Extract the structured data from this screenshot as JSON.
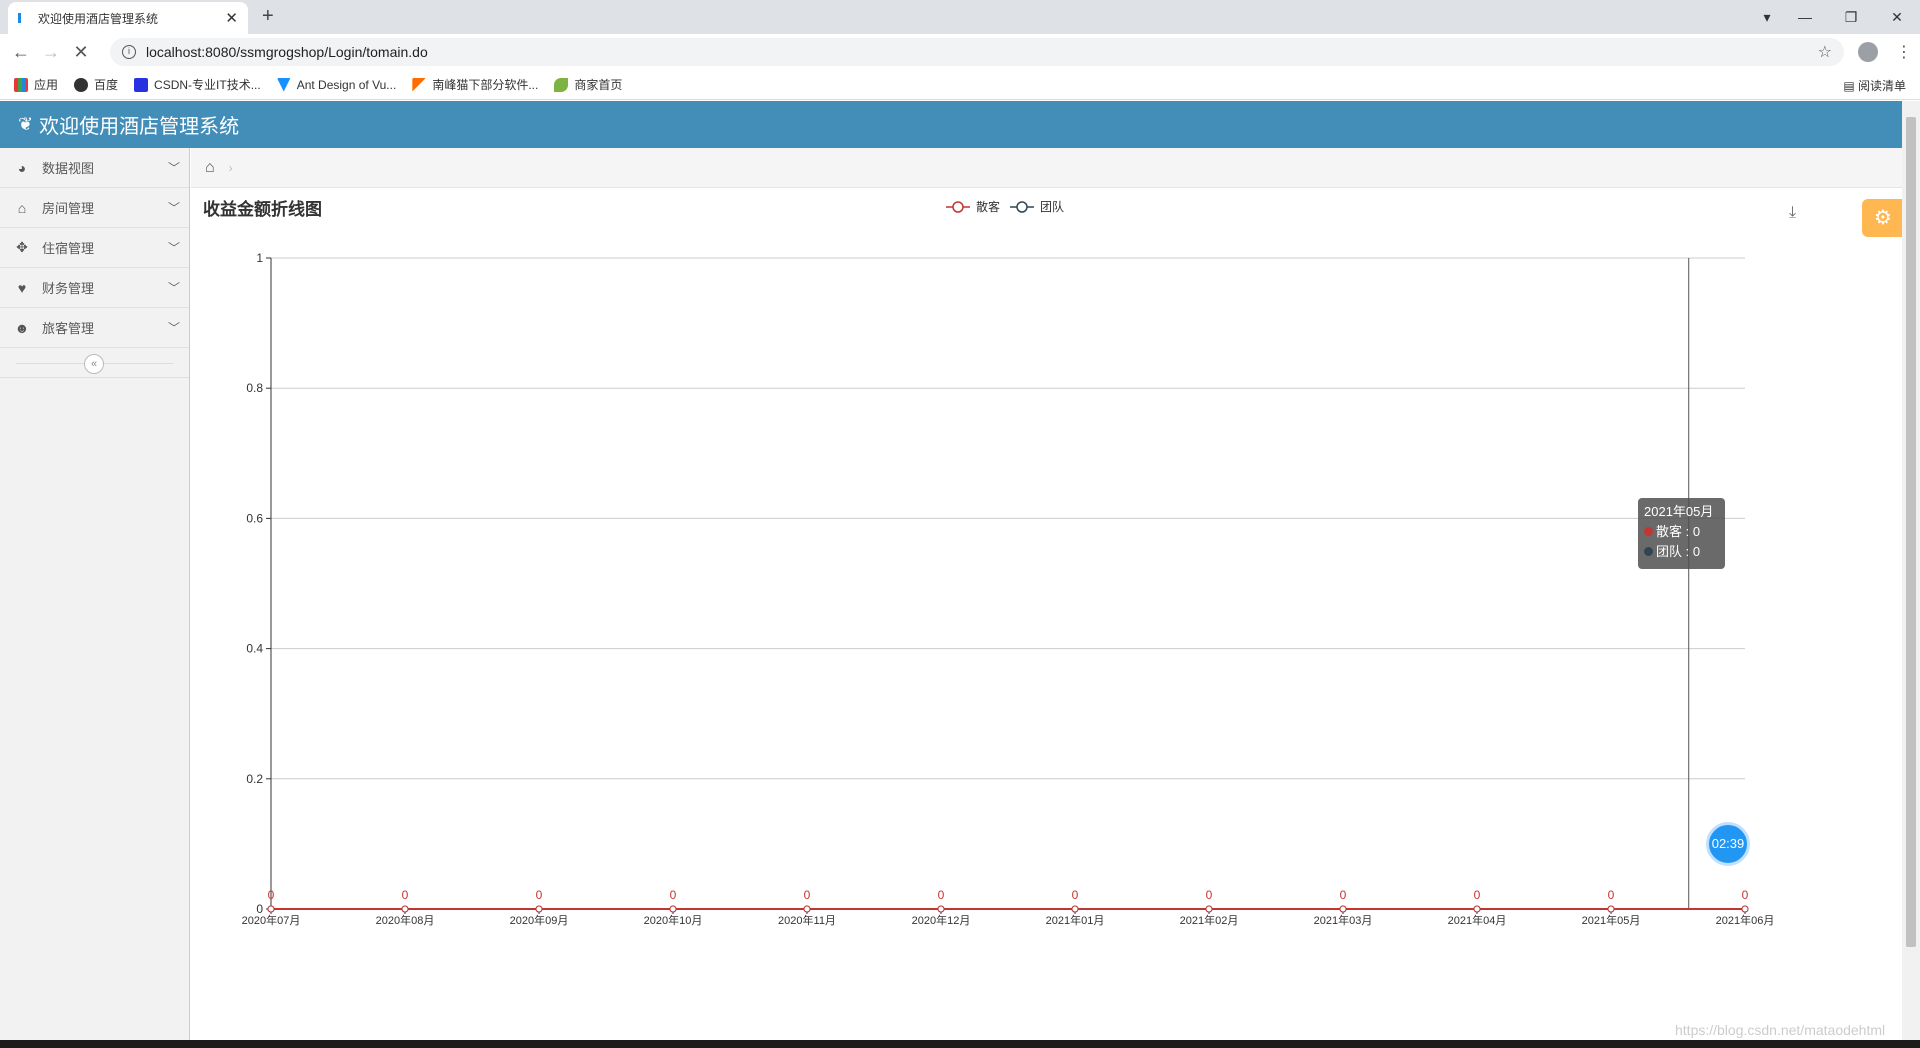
{
  "browser": {
    "tab_title": "欢迎使用酒店管理系统",
    "tab_close": "✕",
    "new_tab": "+",
    "url": "localhost:8080/ssmgrogshop/Login/tomain.do",
    "bookmarks": [
      "应用",
      "百度",
      "CSDN-专业IT技术...",
      "Ant Design of Vu...",
      "南峰猫下部分软件...",
      "商家首页"
    ],
    "reading_list": "阅读清单"
  },
  "app": {
    "title": "欢迎使用酒店管理系统",
    "sidebar": [
      {
        "label": "数据视图",
        "icon": "dashboard-icon"
      },
      {
        "label": "房间管理",
        "icon": "home-icon"
      },
      {
        "label": "住宿管理",
        "icon": "move-icon"
      },
      {
        "label": "财务管理",
        "icon": "heart-icon"
      },
      {
        "label": "旅客管理",
        "icon": "user-icon"
      }
    ]
  },
  "tooltip": {
    "title": "2021年05月",
    "row1": "散客 : 0",
    "row2": "团队 : 0"
  },
  "timer": "02:39",
  "watermark": "https://blog.csdn.net/mataodehtml",
  "colors": {
    "accent": "#438eb9",
    "series1": "#c23531",
    "series2": "#2f4554"
  },
  "chart_data": {
    "type": "line",
    "title": "收益金额折线图",
    "categories": [
      "2020年07月",
      "2020年08月",
      "2020年09月",
      "2020年10月",
      "2020年11月",
      "2020年12月",
      "2021年01月",
      "2021年02月",
      "2021年03月",
      "2021年04月",
      "2021年05月",
      "2021年06月"
    ],
    "series": [
      {
        "name": "散客",
        "values": [
          0,
          0,
          0,
          0,
          0,
          0,
          0,
          0,
          0,
          0,
          0,
          0
        ]
      },
      {
        "name": "团队",
        "values": [
          0,
          0,
          0,
          0,
          0,
          0,
          0,
          0,
          0,
          0,
          0,
          0
        ]
      }
    ],
    "ylim": [
      0,
      1
    ],
    "yticks": [
      0,
      0.2,
      0.4,
      0.6,
      0.8,
      1
    ],
    "grid": true,
    "legend": "top-center"
  }
}
